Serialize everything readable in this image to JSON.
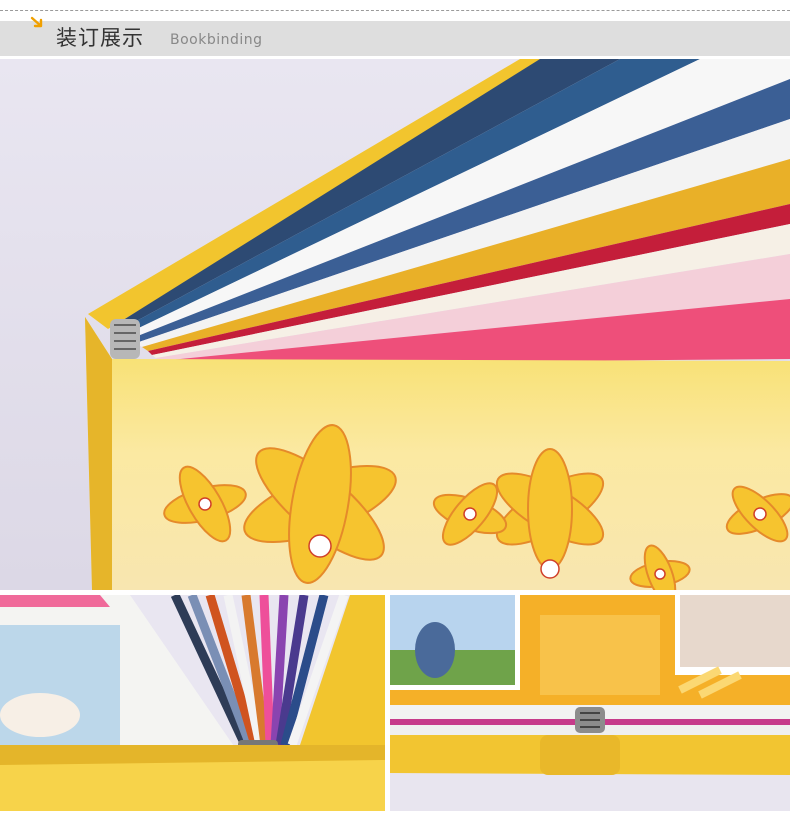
{
  "header": {
    "title": "装订展示",
    "subtitle": "Bookbinding",
    "arrow_icon": "corner-arrow-icon",
    "accent_color": "#f0a000"
  },
  "photos": [
    {
      "id": "main",
      "icon": "photo-album-spine"
    },
    {
      "id": "left",
      "icon": "photo-album-pages"
    },
    {
      "id": "right",
      "icon": "photo-album-open"
    }
  ]
}
